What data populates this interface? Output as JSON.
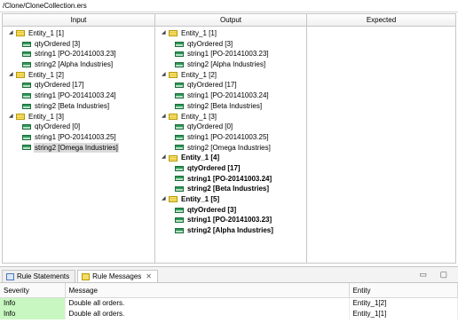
{
  "path": "/Clone/CloneCollection.ers",
  "columns": {
    "input": "Input",
    "output": "Output",
    "expected": "Expected"
  },
  "input_tree": [
    {
      "label": "Entity_1 [1]",
      "level": 0,
      "bold": false,
      "sel": false
    },
    {
      "label": "qtyOrdered [3]",
      "level": 1,
      "bold": false,
      "sel": false
    },
    {
      "label": "string1 [PO-20141003.23]",
      "level": 1,
      "bold": false,
      "sel": false
    },
    {
      "label": "string2 [Alpha Industries]",
      "level": 1,
      "bold": false,
      "sel": false
    },
    {
      "label": "Entity_1 [2]",
      "level": 0,
      "bold": false,
      "sel": false
    },
    {
      "label": "qtyOrdered [17]",
      "level": 1,
      "bold": false,
      "sel": false
    },
    {
      "label": "string1 [PO-20141003.24]",
      "level": 1,
      "bold": false,
      "sel": false
    },
    {
      "label": "string2 [Beta Industries]",
      "level": 1,
      "bold": false,
      "sel": false
    },
    {
      "label": "Entity_1 [3]",
      "level": 0,
      "bold": false,
      "sel": false
    },
    {
      "label": "qtyOrdered [0]",
      "level": 1,
      "bold": false,
      "sel": false
    },
    {
      "label": "string1 [PO-20141003.25]",
      "level": 1,
      "bold": false,
      "sel": false
    },
    {
      "label": "string2 [Omega Industries]",
      "level": 1,
      "bold": false,
      "sel": true
    }
  ],
  "output_tree": [
    {
      "label": "Entity_1 [1]",
      "level": 0,
      "bold": false,
      "sel": false
    },
    {
      "label": "qtyOrdered [3]",
      "level": 1,
      "bold": false,
      "sel": false
    },
    {
      "label": "string1 [PO-20141003.23]",
      "level": 1,
      "bold": false,
      "sel": false
    },
    {
      "label": "string2 [Alpha Industries]",
      "level": 1,
      "bold": false,
      "sel": false
    },
    {
      "label": "Entity_1 [2]",
      "level": 0,
      "bold": false,
      "sel": false
    },
    {
      "label": "qtyOrdered [17]",
      "level": 1,
      "bold": false,
      "sel": false
    },
    {
      "label": "string1 [PO-20141003.24]",
      "level": 1,
      "bold": false,
      "sel": false
    },
    {
      "label": "string2 [Beta Industries]",
      "level": 1,
      "bold": false,
      "sel": false
    },
    {
      "label": "Entity_1 [3]",
      "level": 0,
      "bold": false,
      "sel": false
    },
    {
      "label": "qtyOrdered [0]",
      "level": 1,
      "bold": false,
      "sel": false
    },
    {
      "label": "string1 [PO-20141003.25]",
      "level": 1,
      "bold": false,
      "sel": false
    },
    {
      "label": "string2 [Omega Industries]",
      "level": 1,
      "bold": false,
      "sel": false
    },
    {
      "label": "Entity_1 [4]",
      "level": 0,
      "bold": true,
      "sel": false
    },
    {
      "label": "qtyOrdered [17]",
      "level": 1,
      "bold": true,
      "sel": false
    },
    {
      "label": "string1 [PO-20141003.24]",
      "level": 1,
      "bold": true,
      "sel": false
    },
    {
      "label": "string2 [Beta Industries]",
      "level": 1,
      "bold": true,
      "sel": false
    },
    {
      "label": "Entity_1 [5]",
      "level": 0,
      "bold": true,
      "sel": false
    },
    {
      "label": "qtyOrdered [3]",
      "level": 1,
      "bold": true,
      "sel": false
    },
    {
      "label": "string1 [PO-20141003.23]",
      "level": 1,
      "bold": true,
      "sel": false
    },
    {
      "label": "string2 [Alpha Industries]",
      "level": 1,
      "bold": true,
      "sel": false
    }
  ],
  "tabs": {
    "statements": "Rule Statements",
    "messages": "Rule Messages",
    "close_glyph": "✕",
    "controls": "▭ ▢"
  },
  "messages_table": {
    "headers": {
      "severity": "Severity",
      "message": "Message",
      "entity": "Entity"
    },
    "rows": [
      {
        "severity": "Info",
        "message": "Double all orders.",
        "entity": "Entity_1[2]"
      },
      {
        "severity": "Info",
        "message": "Double all orders.",
        "entity": "Entity_1[1]"
      }
    ]
  },
  "colors": {
    "info_bg": "#c8f7c1",
    "selection": "#dbdbdb"
  }
}
